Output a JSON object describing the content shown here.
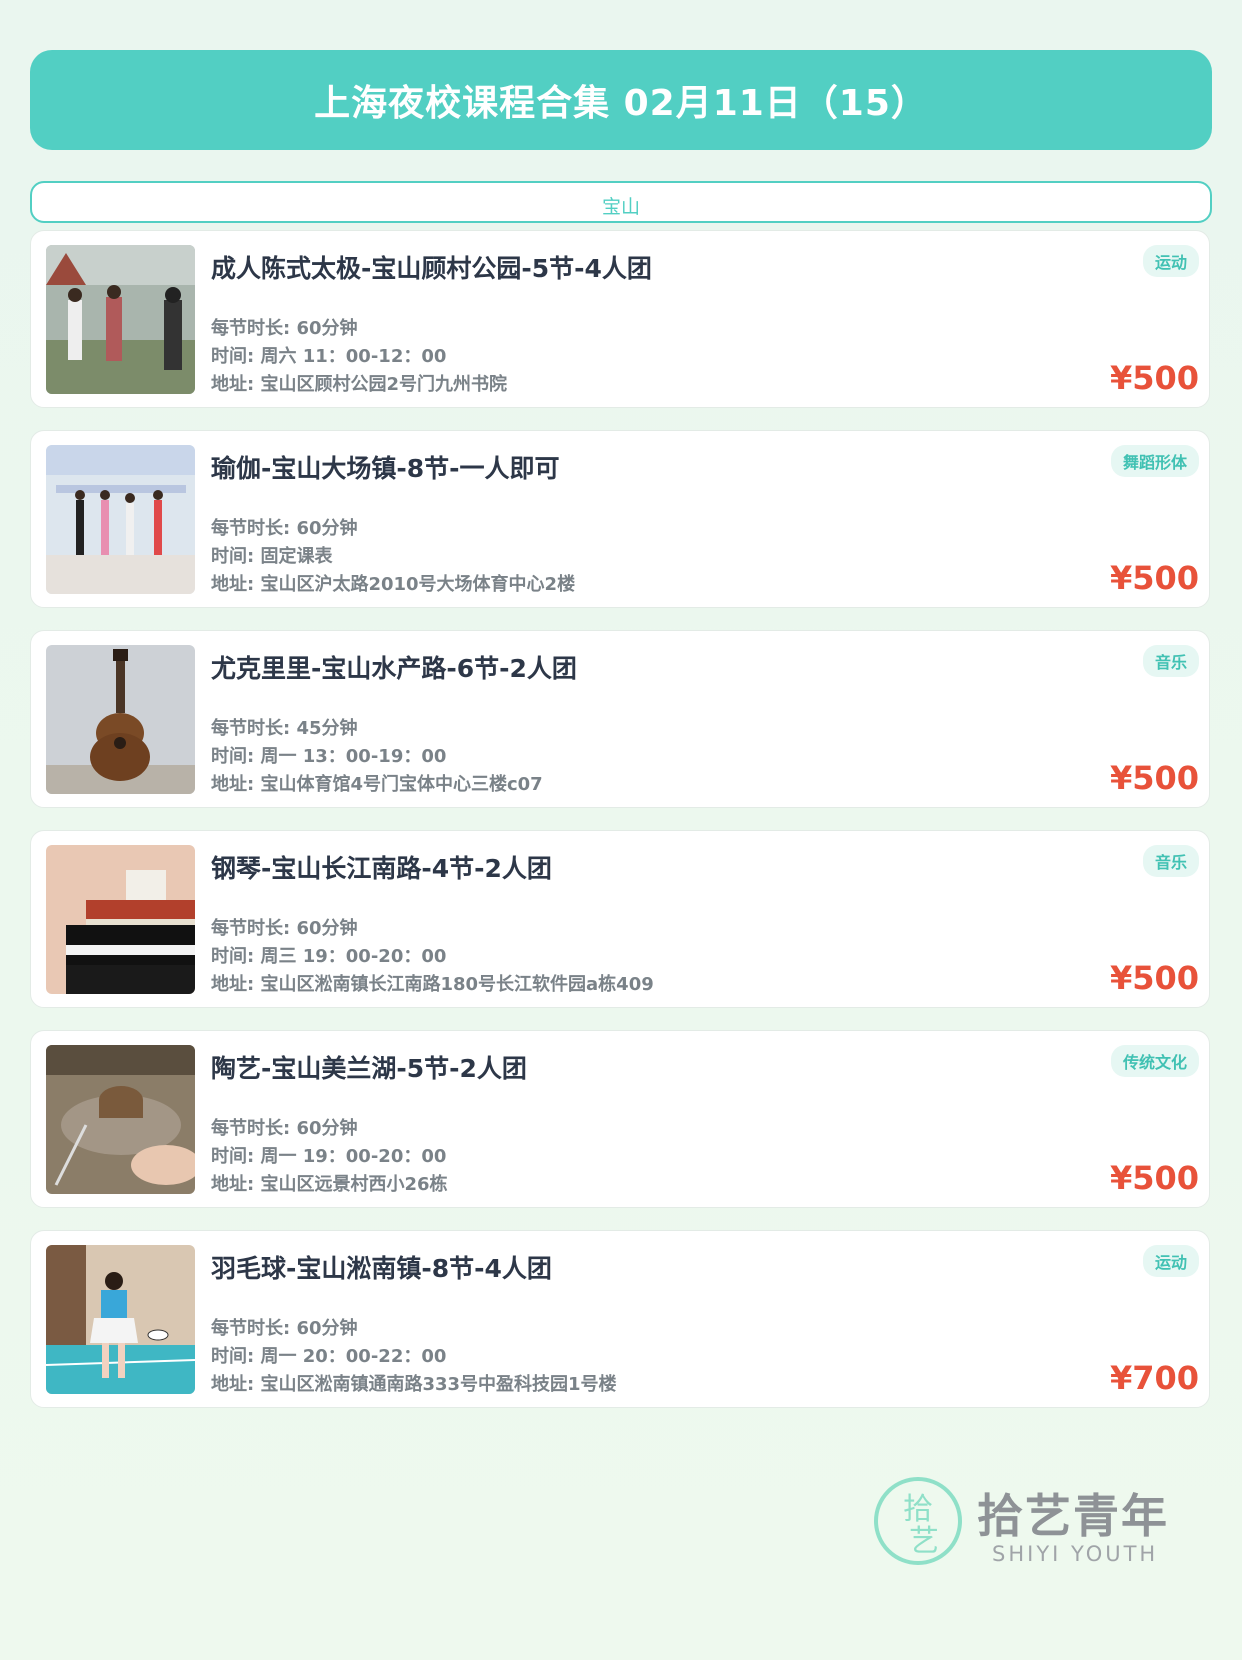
{
  "header": {
    "title": "上海夜校课程合集 02月11日（15）"
  },
  "region": {
    "label": "宝山"
  },
  "courses": [
    {
      "title": "成人陈式太极-宝山顾村公园-5节-4人团",
      "duration": "每节时长: 60分钟",
      "time": "时间: 周六 11：00-12：00",
      "address": "地址: 宝山区顾村公园2号门九州书院",
      "tag": "运动",
      "price": "¥500"
    },
    {
      "title": "瑜伽-宝山大场镇-8节-一人即可",
      "duration": "每节时长: 60分钟",
      "time": "时间: 固定课表",
      "address": "地址: 宝山区沪太路2010号大场体育中心2楼",
      "tag": "舞蹈形体",
      "price": "¥500"
    },
    {
      "title": "尤克里里-宝山水产路-6节-2人团",
      "duration": "每节时长: 45分钟",
      "time": "时间: 周一 13：00-19：00",
      "address": "地址: 宝山体育馆4号门宝体中心三楼c07",
      "tag": "音乐",
      "price": "¥500"
    },
    {
      "title": "钢琴-宝山长江南路-4节-2人团",
      "duration": "每节时长: 60分钟",
      "time": "时间: 周三 19：00-20：00",
      "address": "地址: 宝山区淞南镇长江南路180号长江软件园a栋409",
      "tag": "音乐",
      "price": "¥500"
    },
    {
      "title": "陶艺-宝山美兰湖-5节-2人团",
      "duration": "每节时长: 60分钟",
      "time": "时间: 周一 19：00-20：00",
      "address": "地址: 宝山区远景村西小26栋",
      "tag": "传统文化",
      "price": "¥500"
    },
    {
      "title": "羽毛球-宝山淞南镇-8节-4人团",
      "duration": "每节时长: 60分钟",
      "time": "时间: 周一 20：00-22：00",
      "address": "地址: 宝山区淞南镇通南路333号中盈科技园1号楼",
      "tag": "运动",
      "price": "¥700"
    }
  ],
  "logo": {
    "cn": "拾艺青年",
    "en": "SHIYI YOUTH",
    "mark": "拾艺"
  },
  "colors": {
    "accent": "#52cfc3",
    "price": "#e8523a",
    "tag_bg": "#e6f7f3"
  }
}
